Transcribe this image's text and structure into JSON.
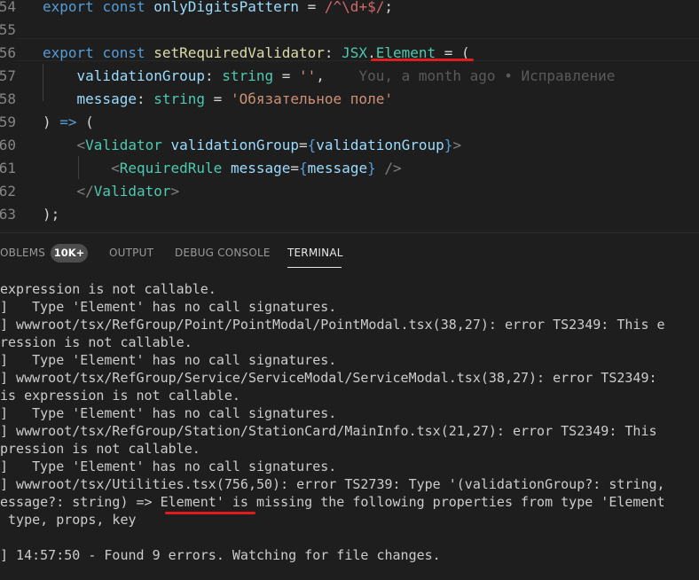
{
  "editor": {
    "lines": [
      {
        "num": "54",
        "tokens": [
          {
            "t": "export ",
            "c": "kw"
          },
          {
            "t": "const ",
            "c": "kw"
          },
          {
            "t": "onlyDigitsPattern",
            "c": "var"
          },
          {
            "t": " = ",
            "c": "plain"
          },
          {
            "t": "/^\\d+$/",
            "c": "re"
          },
          {
            "t": ";",
            "c": "plain"
          }
        ]
      },
      {
        "num": "55",
        "tokens": []
      },
      {
        "num": "56",
        "tokens": [
          {
            "t": "export ",
            "c": "kw"
          },
          {
            "t": "const ",
            "c": "kw"
          },
          {
            "t": "setRequiredValidator",
            "c": "id"
          },
          {
            "t": ": ",
            "c": "plain"
          },
          {
            "t": "JSX",
            "c": "type"
          },
          {
            "t": ".",
            "c": "plain"
          },
          {
            "t": "Element",
            "c": "type"
          },
          {
            "t": " = (",
            "c": "plain"
          }
        ]
      },
      {
        "num": "57",
        "tokens": [
          {
            "t": "    validationGroup",
            "c": "var"
          },
          {
            "t": ": ",
            "c": "plain"
          },
          {
            "t": "string",
            "c": "type"
          },
          {
            "t": " = ",
            "c": "plain"
          },
          {
            "t": "''",
            "c": "str"
          },
          {
            "t": ",",
            "c": "plain"
          }
        ],
        "blame": "You, a month ago • Исправление"
      },
      {
        "num": "58",
        "tokens": [
          {
            "t": "    message",
            "c": "var"
          },
          {
            "t": ": ",
            "c": "plain"
          },
          {
            "t": "string",
            "c": "type"
          },
          {
            "t": " = ",
            "c": "plain"
          },
          {
            "t": "'Обязательное поле'",
            "c": "str"
          }
        ]
      },
      {
        "num": "59",
        "tokens": [
          {
            "t": ") ",
            "c": "plain"
          },
          {
            "t": "=>",
            "c": "kw"
          },
          {
            "t": " (",
            "c": "plain"
          }
        ]
      },
      {
        "num": "60",
        "tokens": [
          {
            "t": "    ",
            "c": "plain"
          },
          {
            "t": "<",
            "c": "tag"
          },
          {
            "t": "Validator",
            "c": "jsx"
          },
          {
            "t": " ",
            "c": "plain"
          },
          {
            "t": "validationGroup",
            "c": "var"
          },
          {
            "t": "=",
            "c": "plain"
          },
          {
            "t": "{",
            "c": "kw"
          },
          {
            "t": "validationGroup",
            "c": "var"
          },
          {
            "t": "}",
            "c": "kw"
          },
          {
            "t": ">",
            "c": "tag"
          }
        ]
      },
      {
        "num": "61",
        "tokens": [
          {
            "t": "        ",
            "c": "plain"
          },
          {
            "t": "<",
            "c": "tag"
          },
          {
            "t": "RequiredRule",
            "c": "jsx"
          },
          {
            "t": " ",
            "c": "plain"
          },
          {
            "t": "message",
            "c": "var"
          },
          {
            "t": "=",
            "c": "plain"
          },
          {
            "t": "{",
            "c": "kw"
          },
          {
            "t": "message",
            "c": "var"
          },
          {
            "t": "}",
            "c": "kw"
          },
          {
            "t": " />",
            "c": "tag"
          }
        ]
      },
      {
        "num": "62",
        "tokens": [
          {
            "t": "    ",
            "c": "plain"
          },
          {
            "t": "</",
            "c": "tag"
          },
          {
            "t": "Validator",
            "c": "jsx"
          },
          {
            "t": ">",
            "c": "tag"
          }
        ]
      },
      {
        "num": "63",
        "tokens": [
          {
            "t": ");",
            "c": "plain"
          }
        ]
      }
    ]
  },
  "panel": {
    "tabs": [
      {
        "label": "OBLEMS",
        "active": false
      },
      {
        "label": "OUTPUT",
        "active": false
      },
      {
        "label": "DEBUG CONSOLE",
        "active": false
      },
      {
        "label": "TERMINAL",
        "active": true
      }
    ],
    "problems_count": "10K+"
  },
  "terminal": {
    "lines": [
      "expression is not callable.",
      "]   Type 'Element' has no call signatures.",
      "] wwwroot/tsx/RefGroup/Point/PointModal/PointModal.tsx(38,27): error TS2349: This e",
      "ression is not callable.",
      "]   Type 'Element' has no call signatures.",
      "] wwwroot/tsx/RefGroup/Service/ServiceModal/ServiceModal.tsx(38,27): error TS2349:",
      "is expression is not callable.",
      "]   Type 'Element' has no call signatures.",
      "] wwwroot/tsx/RefGroup/Station/StationCard/MainInfo.tsx(21,27): error TS2349: This",
      "pression is not callable.",
      "]   Type 'Element' has no call signatures.",
      "] wwwroot/tsx/Utilities.tsx(756,50): error TS2739: Type '(validationGroup?: string,",
      "essage?: string) => Element' is missing the following properties from type 'Element",
      " type, props, key",
      "",
      "] 14:57:50 - Found 9 errors. Watching for file changes."
    ]
  }
}
